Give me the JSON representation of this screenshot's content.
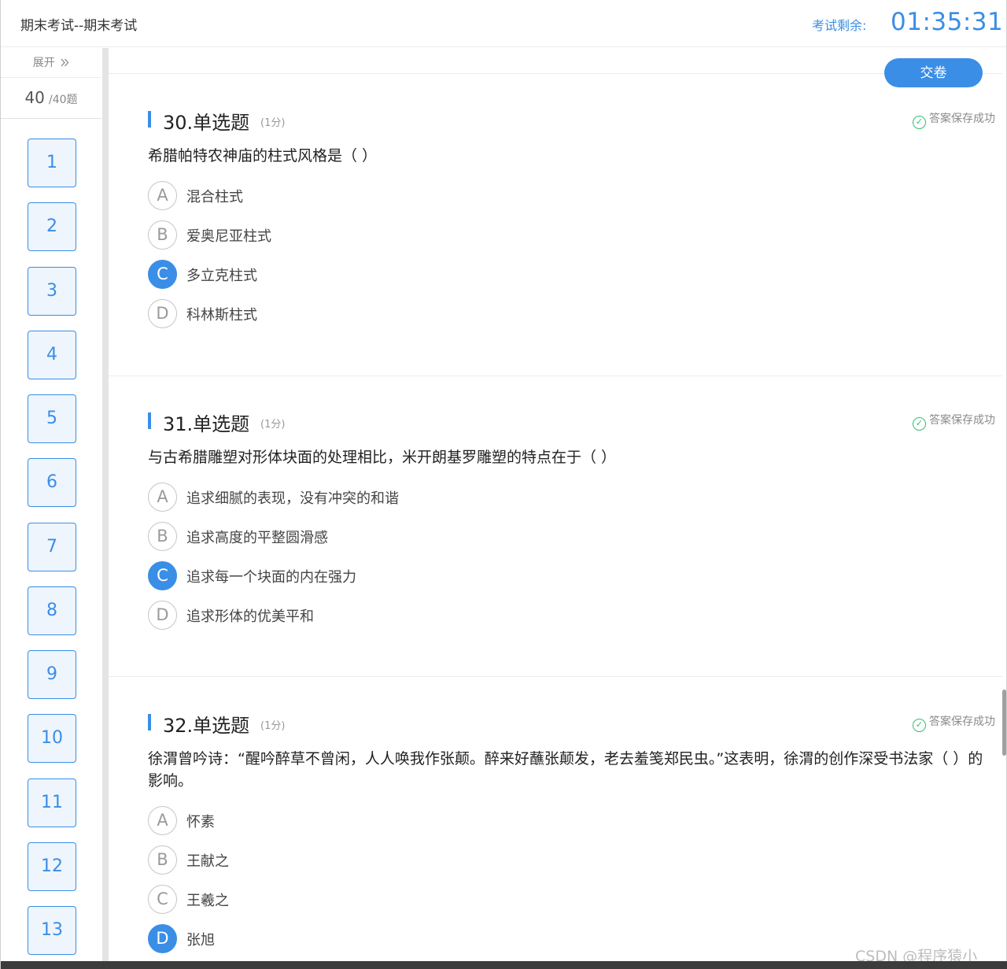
{
  "header": {
    "title": "期末考试--期末考试",
    "timer_label": "考试剩余:",
    "timer": "01:35:31"
  },
  "sidebar": {
    "expand_label": "展开",
    "expand_icon": "double-chevron-right-icon",
    "answered_count": "40",
    "total_label": "/40题",
    "question_numbers": [
      "1",
      "2",
      "3",
      "4",
      "5",
      "6",
      "7",
      "8",
      "9",
      "10",
      "11",
      "12",
      "13"
    ]
  },
  "main": {
    "submit_label": "交卷",
    "questions": [
      {
        "title": "30.单选题",
        "score": "(1分)",
        "saved": "答案保存成功",
        "text": "希腊帕特农神庙的柱式风格是（ ）",
        "options": [
          {
            "letter": "A",
            "text": "混合柱式"
          },
          {
            "letter": "B",
            "text": "爱奥尼亚柱式"
          },
          {
            "letter": "C",
            "text": "多立克柱式"
          },
          {
            "letter": "D",
            "text": "科林斯柱式"
          }
        ],
        "selected": "C"
      },
      {
        "title": "31.单选题",
        "score": "(1分)",
        "saved": "答案保存成功",
        "text": "与古希腊雕塑对形体块面的处理相比，米开朗基罗雕塑的特点在于（ ）",
        "options": [
          {
            "letter": "A",
            "text": "追求细腻的表现，没有冲突的和谐"
          },
          {
            "letter": "B",
            "text": "追求高度的平整圆滑感"
          },
          {
            "letter": "C",
            "text": "追求每一个块面的内在强力"
          },
          {
            "letter": "D",
            "text": "追求形体的优美平和"
          }
        ],
        "selected": "C"
      },
      {
        "title": "32.单选题",
        "score": "(1分)",
        "saved": "答案保存成功",
        "text": "徐渭曾吟诗：“醒吟醉草不曾闲，人人唤我作张颠。醉来好蘸张颠发，老去羞笺郑民虫。”这表明，徐渭的创作深受书法家（ ）的影响。",
        "options": [
          {
            "letter": "A",
            "text": "怀素"
          },
          {
            "letter": "B",
            "text": "王献之"
          },
          {
            "letter": "C",
            "text": "王羲之"
          },
          {
            "letter": "D",
            "text": "张旭"
          }
        ],
        "selected": "D"
      }
    ]
  },
  "watermark": "CSDN @程序猿小胖。",
  "colors": {
    "accent": "#3a8ee6",
    "saved_check": "#2fbf71"
  }
}
